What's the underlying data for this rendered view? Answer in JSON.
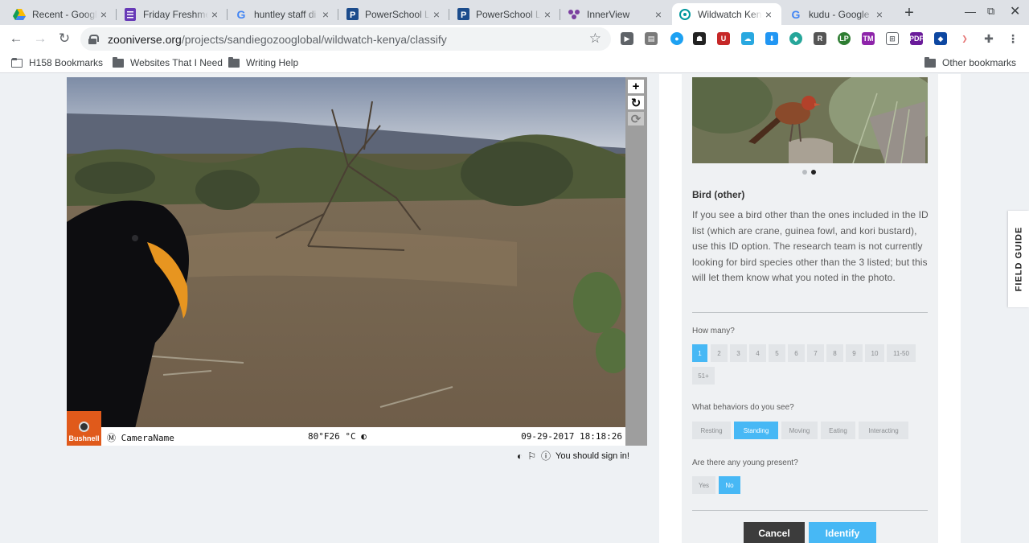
{
  "browser": {
    "tabs": [
      {
        "title": "Recent - Google",
        "icon": "drive-icon"
      },
      {
        "title": "Friday Freshme",
        "icon": "forms-icon"
      },
      {
        "title": "huntley staff di",
        "icon": "google-icon"
      },
      {
        "title": "PowerSchool Le",
        "icon": "powerschool-icon"
      },
      {
        "title": "PowerSchool Le",
        "icon": "powerschool-icon"
      },
      {
        "title": "InnerView",
        "icon": "innerview-icon"
      },
      {
        "title": "Wildwatch Ken",
        "icon": "zooniverse-icon"
      },
      {
        "title": "kudu - Google S",
        "icon": "google-icon"
      }
    ],
    "close_glyph": "×",
    "new_tab": "+",
    "url_host": "zooniverse.org",
    "url_path": "/projects/sandiegozooglobal/wildwatch-kenya/classify",
    "bookmarks": [
      "H158 Bookmarks",
      "Websites That I Need",
      "Writing Help"
    ],
    "other_bookmarks": "Other bookmarks"
  },
  "viewer": {
    "camera_name": "CameraName",
    "temperature": "80°F26 °C",
    "timestamp": "09-29-2017 18:18:26",
    "brand": "Bushnell",
    "sign_in_prompt": "You should sign in!",
    "tools": [
      "+",
      "↻",
      "⟳"
    ]
  },
  "task": {
    "choice_title": "Bird (other)",
    "choice_description": "If you see a bird other than the ones included in the ID list (which are crane, guinea fowl, and kori bustard), use this ID option. The research team is not currently looking for bird species other than the 3 listed; but this will let them know what you noted in the photo.",
    "how_many_label": "How many?",
    "how_many_options": [
      "1",
      "2",
      "3",
      "4",
      "5",
      "6",
      "7",
      "8",
      "9",
      "10",
      "11-50",
      "51+"
    ],
    "how_many_selected": "1",
    "behaviors_label": "What behaviors do you see?",
    "behaviors": [
      "Resting",
      "Standing",
      "Moving",
      "Eating",
      "Interacting"
    ],
    "behaviors_selected": [
      "Standing"
    ],
    "young_label": "Are there any young present?",
    "young_options": [
      "Yes",
      "No"
    ],
    "young_selected": "No",
    "cancel_label": "Cancel",
    "identify_label": "Identify"
  },
  "field_guide_label": "FIELD GUIDE",
  "colors": {
    "accent": "#47b8f5",
    "dark_button": "#3c3c3c",
    "bushnell": "#e05a1b"
  }
}
